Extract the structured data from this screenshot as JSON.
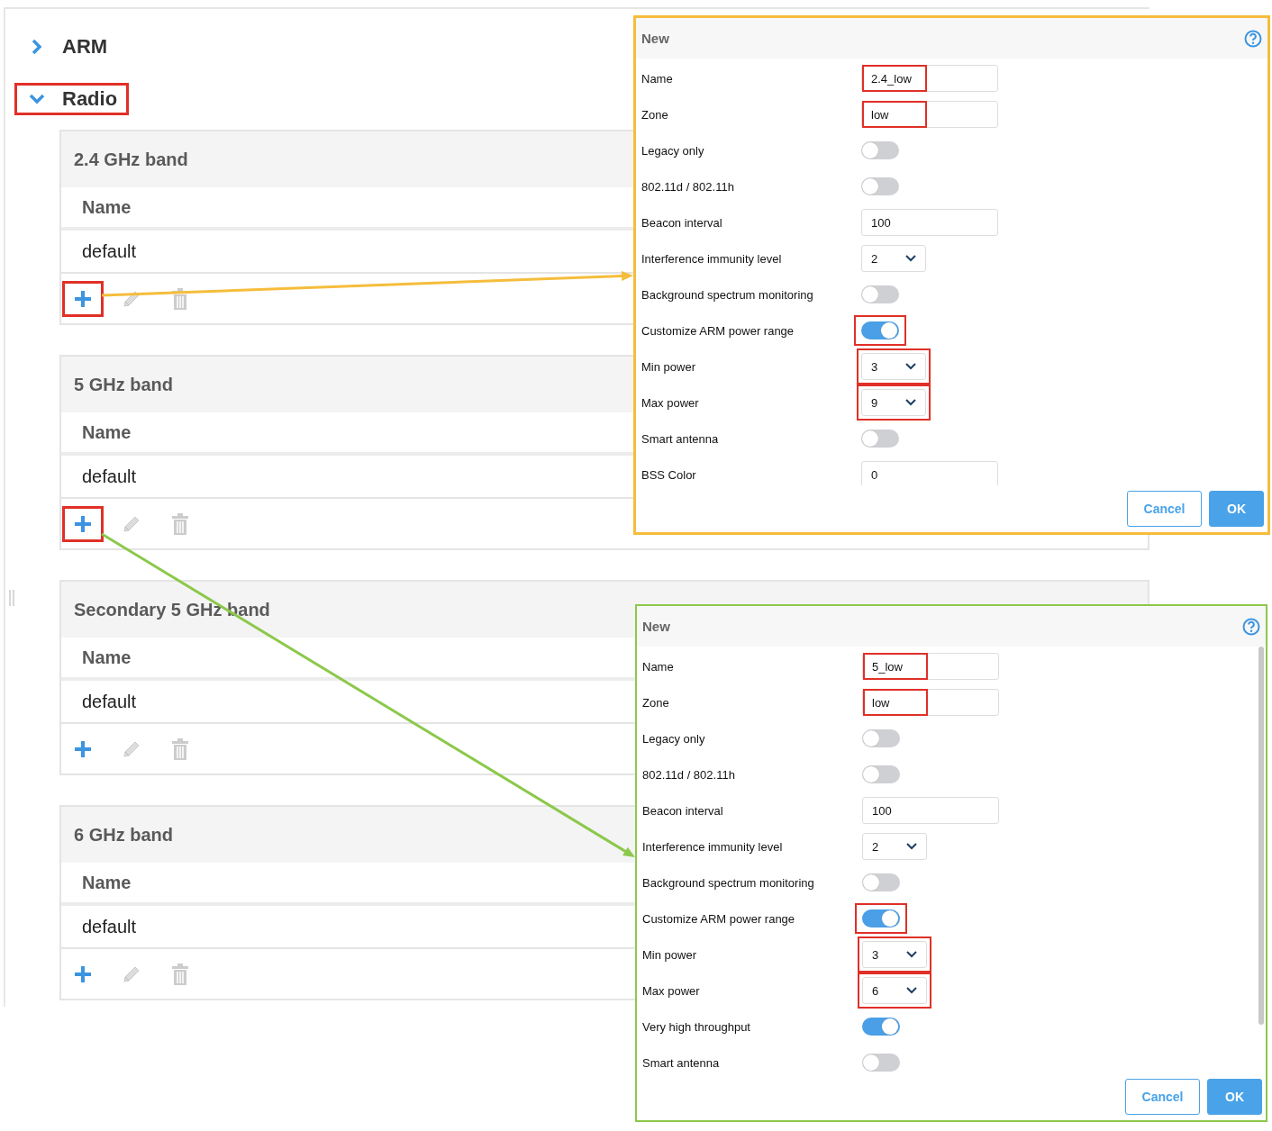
{
  "tree": [
    {
      "label": "ARM",
      "expanded": false,
      "highlighted": false
    },
    {
      "label": "Radio",
      "expanded": true,
      "highlighted": true,
      "bands": [
        {
          "title": "2.4 GHz band",
          "column": "Name",
          "rows": [
            "default"
          ],
          "add_highlighted": true
        },
        {
          "title": "5 GHz band",
          "column": "Name",
          "rows": [
            "default"
          ],
          "add_highlighted": true
        },
        {
          "title": "Secondary 5 GHz band",
          "column": "Name",
          "rows": [
            "default"
          ],
          "add_highlighted": false
        },
        {
          "title": "6 GHz band",
          "column": "Name",
          "rows": [
            "default"
          ],
          "add_highlighted": false
        }
      ]
    }
  ],
  "dialogs": [
    {
      "title": "New",
      "color": "#f5bd3b",
      "buttons": [
        "Cancel",
        "OK"
      ],
      "fields": [
        {
          "kind": "text",
          "label": "Name",
          "value": "2.4_low",
          "highlighted": true
        },
        {
          "kind": "text",
          "label": "Zone",
          "value": "low",
          "highlighted": true
        },
        {
          "kind": "toggle",
          "label": "Legacy only",
          "on": false,
          "highlighted": false
        },
        {
          "kind": "toggle",
          "label": "802.11d / 802.11h",
          "on": false,
          "highlighted": false
        },
        {
          "kind": "text",
          "label": "Beacon interval",
          "value": "100",
          "highlighted": false
        },
        {
          "kind": "select",
          "label": "Interference immunity level",
          "value": "2",
          "highlighted": false
        },
        {
          "kind": "toggle",
          "label": "Background spectrum monitoring",
          "on": false,
          "highlighted": false
        },
        {
          "kind": "toggle",
          "label": "Customize ARM power range",
          "on": true,
          "highlighted": true
        },
        {
          "kind": "select",
          "label": "Min power",
          "value": "3",
          "highlighted": true
        },
        {
          "kind": "select",
          "label": "Max power",
          "value": "9",
          "highlighted": true
        },
        {
          "kind": "toggle",
          "label": "Smart antenna",
          "on": false,
          "highlighted": false
        },
        {
          "kind": "text",
          "label": "BSS Color",
          "value": "0",
          "highlighted": false
        }
      ]
    },
    {
      "title": "New",
      "color": "#8cc84b",
      "buttons": [
        "Cancel",
        "OK"
      ],
      "fields": [
        {
          "kind": "text",
          "label": "Name",
          "value": "5_low",
          "highlighted": true
        },
        {
          "kind": "text",
          "label": "Zone",
          "value": "low",
          "highlighted": true
        },
        {
          "kind": "toggle",
          "label": "Legacy only",
          "on": false,
          "highlighted": false
        },
        {
          "kind": "toggle",
          "label": "802.11d / 802.11h",
          "on": false,
          "highlighted": false
        },
        {
          "kind": "text",
          "label": "Beacon interval",
          "value": "100",
          "highlighted": false
        },
        {
          "kind": "select",
          "label": "Interference immunity level",
          "value": "2",
          "highlighted": false
        },
        {
          "kind": "toggle",
          "label": "Background spectrum monitoring",
          "on": false,
          "highlighted": false
        },
        {
          "kind": "toggle",
          "label": "Customize ARM power range",
          "on": true,
          "highlighted": true
        },
        {
          "kind": "select",
          "label": "Min power",
          "value": "3",
          "highlighted": true
        },
        {
          "kind": "select",
          "label": "Max power",
          "value": "6",
          "highlighted": true
        },
        {
          "kind": "toggle",
          "label": "Very high throughput",
          "on": true,
          "highlighted": false
        },
        {
          "kind": "toggle",
          "label": "Smart antenna",
          "on": false,
          "highlighted": false
        }
      ]
    }
  ]
}
